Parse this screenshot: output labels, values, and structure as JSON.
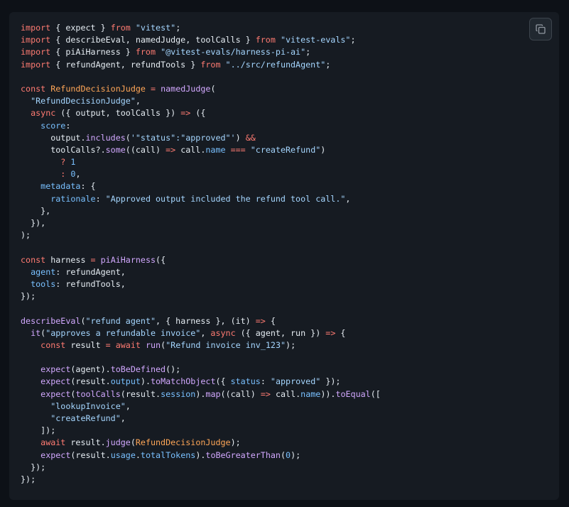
{
  "copy_button": {
    "icon": "copy-icon"
  },
  "code_lines": [
    [
      [
        "k",
        "import"
      ],
      [
        "t",
        " { expect } "
      ],
      [
        "k",
        "from"
      ],
      [
        "t",
        " "
      ],
      [
        "s",
        "\"vitest\""
      ],
      [
        "t",
        ";"
      ]
    ],
    [
      [
        "k",
        "import"
      ],
      [
        "t",
        " { describeEval, namedJudge, toolCalls } "
      ],
      [
        "k",
        "from"
      ],
      [
        "t",
        " "
      ],
      [
        "s",
        "\"vitest-evals\""
      ],
      [
        "t",
        ";"
      ]
    ],
    [
      [
        "k",
        "import"
      ],
      [
        "t",
        " { piAiHarness } "
      ],
      [
        "k",
        "from"
      ],
      [
        "t",
        " "
      ],
      [
        "s",
        "\"@vitest-evals/harness-pi-ai\""
      ],
      [
        "t",
        ";"
      ]
    ],
    [
      [
        "k",
        "import"
      ],
      [
        "t",
        " { refundAgent, refundTools } "
      ],
      [
        "k",
        "from"
      ],
      [
        "t",
        " "
      ],
      [
        "s",
        "\"../src/refundAgent\""
      ],
      [
        "t",
        ";"
      ]
    ],
    [],
    [
      [
        "k",
        "const"
      ],
      [
        "t",
        " "
      ],
      [
        "c",
        "RefundDecisionJudge"
      ],
      [
        "t",
        " "
      ],
      [
        "k",
        "="
      ],
      [
        "t",
        " "
      ],
      [
        "f",
        "namedJudge"
      ],
      [
        "t",
        "("
      ]
    ],
    [
      [
        "t",
        "  "
      ],
      [
        "s",
        "\"RefundDecisionJudge\""
      ],
      [
        "t",
        ","
      ]
    ],
    [
      [
        "t",
        "  "
      ],
      [
        "k",
        "async"
      ],
      [
        "t",
        " ({ output, toolCalls }) "
      ],
      [
        "k",
        "=>"
      ],
      [
        "t",
        " ({"
      ]
    ],
    [
      [
        "t",
        "    "
      ],
      [
        "p",
        "score"
      ],
      [
        "t",
        ":"
      ]
    ],
    [
      [
        "t",
        "      output."
      ],
      [
        "f",
        "includes"
      ],
      [
        "t",
        "("
      ],
      [
        "s",
        "'\"status\":\"approved\"'"
      ],
      [
        "t",
        ") "
      ],
      [
        "k",
        "&&"
      ]
    ],
    [
      [
        "t",
        "      toolCalls?."
      ],
      [
        "f",
        "some"
      ],
      [
        "t",
        "((call) "
      ],
      [
        "k",
        "=>"
      ],
      [
        "t",
        " call."
      ],
      [
        "p",
        "name"
      ],
      [
        "t",
        " "
      ],
      [
        "k",
        "==="
      ],
      [
        "t",
        " "
      ],
      [
        "s",
        "\"createRefund\""
      ],
      [
        "t",
        ")"
      ]
    ],
    [
      [
        "t",
        "        "
      ],
      [
        "k",
        "?"
      ],
      [
        "t",
        " "
      ],
      [
        "p",
        "1"
      ]
    ],
    [
      [
        "t",
        "        "
      ],
      [
        "k",
        ":"
      ],
      [
        "t",
        " "
      ],
      [
        "p",
        "0"
      ],
      [
        "t",
        ","
      ]
    ],
    [
      [
        "t",
        "    "
      ],
      [
        "p",
        "metadata"
      ],
      [
        "t",
        ": {"
      ]
    ],
    [
      [
        "t",
        "      "
      ],
      [
        "p",
        "rationale"
      ],
      [
        "t",
        ": "
      ],
      [
        "s",
        "\"Approved output included the refund tool call.\""
      ],
      [
        "t",
        ","
      ]
    ],
    [
      [
        "t",
        "    },"
      ]
    ],
    [
      [
        "t",
        "  }),"
      ]
    ],
    [
      [
        "t",
        ");"
      ]
    ],
    [],
    [
      [
        "k",
        "const"
      ],
      [
        "t",
        " harness "
      ],
      [
        "k",
        "="
      ],
      [
        "t",
        " "
      ],
      [
        "f",
        "piAiHarness"
      ],
      [
        "t",
        "({"
      ]
    ],
    [
      [
        "t",
        "  "
      ],
      [
        "p",
        "agent"
      ],
      [
        "t",
        ": refundAgent,"
      ]
    ],
    [
      [
        "t",
        "  "
      ],
      [
        "p",
        "tools"
      ],
      [
        "t",
        ": refundTools,"
      ]
    ],
    [
      [
        "t",
        "});"
      ]
    ],
    [],
    [
      [
        "f",
        "describeEval"
      ],
      [
        "t",
        "("
      ],
      [
        "s",
        "\"refund agent\""
      ],
      [
        "t",
        ", { harness }, (it) "
      ],
      [
        "k",
        "=>"
      ],
      [
        "t",
        " {"
      ]
    ],
    [
      [
        "t",
        "  "
      ],
      [
        "f",
        "it"
      ],
      [
        "t",
        "("
      ],
      [
        "s",
        "\"approves a refundable invoice\""
      ],
      [
        "t",
        ", "
      ],
      [
        "k",
        "async"
      ],
      [
        "t",
        " ({ agent, run }) "
      ],
      [
        "k",
        "=>"
      ],
      [
        "t",
        " {"
      ]
    ],
    [
      [
        "t",
        "    "
      ],
      [
        "k",
        "const"
      ],
      [
        "t",
        " result "
      ],
      [
        "k",
        "="
      ],
      [
        "t",
        " "
      ],
      [
        "k",
        "await"
      ],
      [
        "t",
        " "
      ],
      [
        "f",
        "run"
      ],
      [
        "t",
        "("
      ],
      [
        "s",
        "\"Refund invoice inv_123\""
      ],
      [
        "t",
        ");"
      ]
    ],
    [],
    [
      [
        "t",
        "    "
      ],
      [
        "f",
        "expect"
      ],
      [
        "t",
        "(agent)."
      ],
      [
        "f",
        "toBeDefined"
      ],
      [
        "t",
        "();"
      ]
    ],
    [
      [
        "t",
        "    "
      ],
      [
        "f",
        "expect"
      ],
      [
        "t",
        "(result."
      ],
      [
        "p",
        "output"
      ],
      [
        "t",
        ")."
      ],
      [
        "f",
        "toMatchObject"
      ],
      [
        "t",
        "({ "
      ],
      [
        "p",
        "status"
      ],
      [
        "t",
        ": "
      ],
      [
        "s",
        "\"approved\""
      ],
      [
        "t",
        " });"
      ]
    ],
    [
      [
        "t",
        "    "
      ],
      [
        "f",
        "expect"
      ],
      [
        "t",
        "("
      ],
      [
        "f",
        "toolCalls"
      ],
      [
        "t",
        "(result."
      ],
      [
        "p",
        "session"
      ],
      [
        "t",
        ")."
      ],
      [
        "f",
        "map"
      ],
      [
        "t",
        "((call) "
      ],
      [
        "k",
        "=>"
      ],
      [
        "t",
        " call."
      ],
      [
        "p",
        "name"
      ],
      [
        "t",
        "))."
      ],
      [
        "f",
        "toEqual"
      ],
      [
        "t",
        "(["
      ]
    ],
    [
      [
        "t",
        "      "
      ],
      [
        "s",
        "\"lookupInvoice\""
      ],
      [
        "t",
        ","
      ]
    ],
    [
      [
        "t",
        "      "
      ],
      [
        "s",
        "\"createRefund\""
      ],
      [
        "t",
        ","
      ]
    ],
    [
      [
        "t",
        "    ]);"
      ]
    ],
    [
      [
        "t",
        "    "
      ],
      [
        "k",
        "await"
      ],
      [
        "t",
        " result."
      ],
      [
        "f",
        "judge"
      ],
      [
        "t",
        "("
      ],
      [
        "c",
        "RefundDecisionJudge"
      ],
      [
        "t",
        ");"
      ]
    ],
    [
      [
        "t",
        "    "
      ],
      [
        "f",
        "expect"
      ],
      [
        "t",
        "(result."
      ],
      [
        "p",
        "usage"
      ],
      [
        "t",
        "."
      ],
      [
        "p",
        "totalTokens"
      ],
      [
        "t",
        ")."
      ],
      [
        "f",
        "toBeGreaterThan"
      ],
      [
        "t",
        "("
      ],
      [
        "p",
        "0"
      ],
      [
        "t",
        ");"
      ]
    ],
    [
      [
        "t",
        "  });"
      ]
    ],
    [
      [
        "t",
        "});"
      ]
    ]
  ]
}
